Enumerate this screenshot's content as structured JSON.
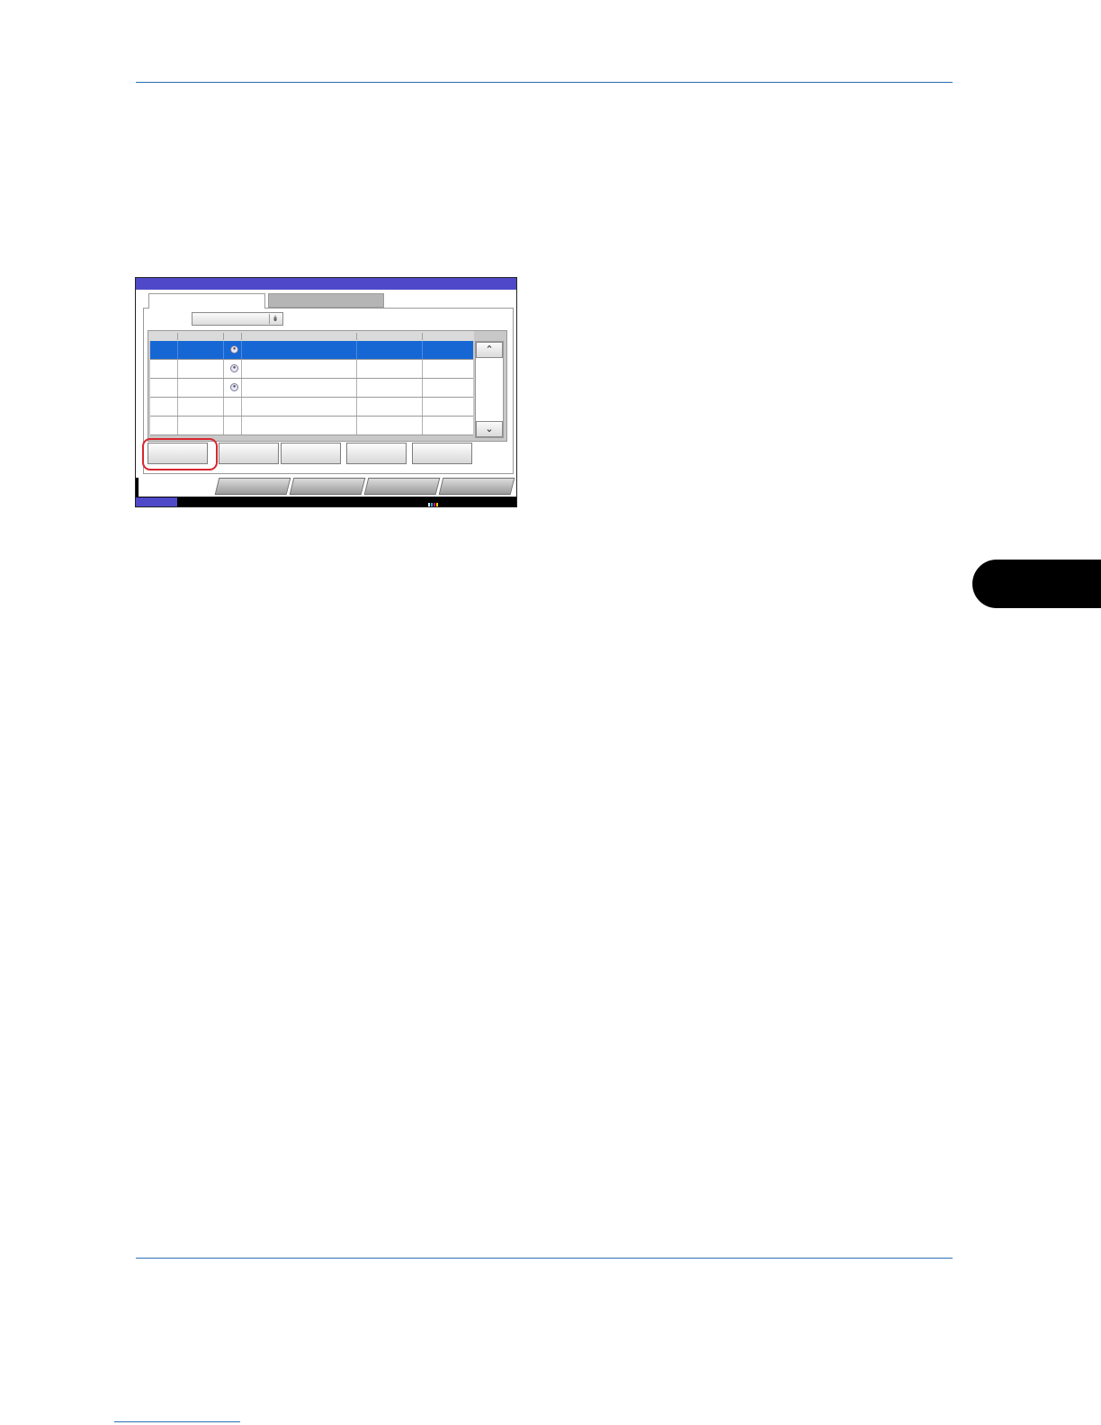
{
  "page": {
    "header_rule": "",
    "footer_rule": ""
  },
  "panel": {
    "tabs": [
      "",
      ""
    ],
    "dropdown_value": "",
    "rows": [
      {
        "selected": true,
        "icon": "job-icon"
      },
      {
        "selected": false,
        "icon": "job-icon"
      },
      {
        "selected": false,
        "icon": "job-icon"
      },
      {
        "selected": false,
        "icon": ""
      },
      {
        "selected": false,
        "icon": ""
      }
    ],
    "buttons": [
      "",
      "",
      "",
      "",
      ""
    ],
    "bottom_tabs": [
      "",
      "",
      "",
      ""
    ],
    "colors": {
      "titlebar": "#4f49c9",
      "selected_row": "#1667d4",
      "highlight": "#d8262f",
      "chapter_tab": "#000000"
    }
  }
}
